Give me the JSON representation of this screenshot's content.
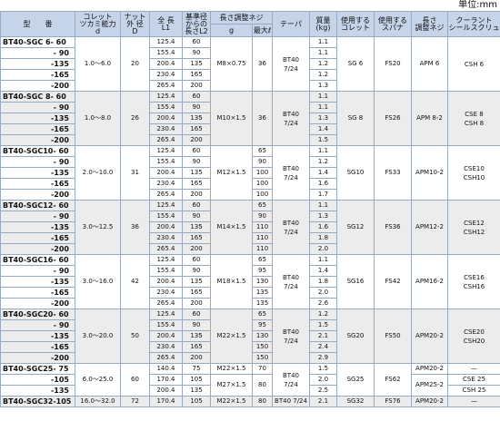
{
  "unit_label": "単位:mm",
  "header": {
    "model": "型　　番",
    "collet_capacity": "コレット",
    "collet_capacity_2": "ツカミ能力",
    "collet_capacity_3": "d",
    "nut_od": "ナット",
    "nut_od_2": "外 径",
    "nut_od_3": "D",
    "length": "全 長",
    "length_2": "L1",
    "ref_length": "基準径",
    "ref_length_2": "からの",
    "ref_length_3": "長さL2",
    "adj_screw": "長さ調整ネジ",
    "adj_screw_g": "g",
    "adj_screw_max": "最大ℓ",
    "taper": "テーパ",
    "mass": "質量",
    "mass_2": "(kg)",
    "collet_used": "使用する",
    "collet_used_2": "コレット",
    "spanner": "使用する",
    "spanner_2": "スパナ",
    "length_adj": "長さ",
    "length_adj_2": "調整ネジ",
    "coolant": "クーラント",
    "coolant_2": "シールスクリュ"
  },
  "groups": [
    {
      "rows": [
        {
          "model": "BT40-SGC  6-  60",
          "L1": "125.4",
          "L2": "60",
          "mass": "1.1"
        },
        {
          "model": "-  90",
          "L1": "155.4",
          "L2": "90",
          "mass": "1.1"
        },
        {
          "model": "-135",
          "L1": "200.4",
          "L2": "135",
          "mass": "1.2"
        },
        {
          "model": "-165",
          "L1": "230.4",
          "L2": "165",
          "mass": "1.2"
        },
        {
          "model": "-200",
          "L1": "265.4",
          "L2": "200",
          "mass": "1.3"
        }
      ],
      "capacity": "1.0〜6.0",
      "nut": "20",
      "g": [
        {
          "text": "M8×0.75",
          "span": 5
        }
      ],
      "lmax": [
        {
          "text": "36",
          "span": 5
        }
      ],
      "taper": "BT40",
      "taper_2": "7/24",
      "collet": "SG 6",
      "spanner": "FS20",
      "adj": "APM  6",
      "coolant": "CSH 6",
      "coolant_2": ""
    },
    {
      "rows": [
        {
          "model": "BT40-SGC  8-  60",
          "L1": "125.4",
          "L2": "60",
          "mass": "1.1"
        },
        {
          "model": "-  90",
          "L1": "155.4",
          "L2": "90",
          "mass": "1.1"
        },
        {
          "model": "-135",
          "L1": "200.4",
          "L2": "135",
          "mass": "1.3"
        },
        {
          "model": "-165",
          "L1": "230.4",
          "L2": "165",
          "mass": "1.4"
        },
        {
          "model": "-200",
          "L1": "265.4",
          "L2": "200",
          "mass": "1.5"
        }
      ],
      "capacity": "1.0〜8.0",
      "nut": "26",
      "g": [
        {
          "text": "M10×1.5",
          "span": 5
        }
      ],
      "lmax": [
        {
          "text": "36",
          "span": 5
        }
      ],
      "taper": "BT40",
      "taper_2": "7/24",
      "collet": "SG 8",
      "spanner": "FS26",
      "adj": "APM  8-2",
      "coolant": "CSE  8",
      "coolant_2": "CSH  8"
    },
    {
      "rows": [
        {
          "model": "BT40-SGC10-  60",
          "L1": "125.4",
          "L2": "60",
          "mass": "1.1"
        },
        {
          "model": "-  90",
          "L1": "155.4",
          "L2": "90",
          "mass": "1.2"
        },
        {
          "model": "-135",
          "L1": "200.4",
          "L2": "135",
          "mass": "1.4"
        },
        {
          "model": "-165",
          "L1": "230.4",
          "L2": "165",
          "mass": "1.6"
        },
        {
          "model": "-200",
          "L1": "265.4",
          "L2": "200",
          "mass": "1.7"
        }
      ],
      "capacity": "2.0〜10.0",
      "nut": "31",
      "g": [
        {
          "text": "M12×1.5",
          "span": 5
        }
      ],
      "lmax_rows": [
        "65",
        "90",
        "100",
        "100",
        "100"
      ],
      "taper": "BT40",
      "taper_2": "7/24",
      "collet": "SG10",
      "spanner": "FS33",
      "adj": "APM10-2",
      "coolant": "CSE10",
      "coolant_2": "CSH10"
    },
    {
      "rows": [
        {
          "model": "BT40-SGC12-  60",
          "L1": "125.4",
          "L2": "60",
          "mass": "1.1"
        },
        {
          "model": "-  90",
          "L1": "155.4",
          "L2": "90",
          "mass": "1.3"
        },
        {
          "model": "-135",
          "L1": "200.4",
          "L2": "135",
          "mass": "1.6"
        },
        {
          "model": "-165",
          "L1": "230.4",
          "L2": "165",
          "mass": "1.8"
        },
        {
          "model": "-200",
          "L1": "265.4",
          "L2": "200",
          "mass": "2.0"
        }
      ],
      "capacity": "3.0〜12.5",
      "nut": "36",
      "g": [
        {
          "text": "M14×1.5",
          "span": 5
        }
      ],
      "lmax_rows": [
        "65",
        "90",
        "110",
        "110",
        "110"
      ],
      "taper": "BT40",
      "taper_2": "7/24",
      "collet": "SG12",
      "spanner": "FS36",
      "adj": "APM12-2",
      "coolant": "CSE12",
      "coolant_2": "CSH12"
    },
    {
      "rows": [
        {
          "model": "BT40-SGC16-  60",
          "L1": "125.4",
          "L2": "60",
          "mass": "1.1"
        },
        {
          "model": "-  90",
          "L1": "155.4",
          "L2": "90",
          "mass": "1.4"
        },
        {
          "model": "-135",
          "L1": "200.4",
          "L2": "135",
          "mass": "1.8"
        },
        {
          "model": "-165",
          "L1": "230.4",
          "L2": "165",
          "mass": "2.0"
        },
        {
          "model": "-200",
          "L1": "265.4",
          "L2": "200",
          "mass": "2.6"
        }
      ],
      "capacity": "3.0〜16.0",
      "nut": "42",
      "g": [
        {
          "text": "M18×1.5",
          "span": 5
        }
      ],
      "lmax_rows": [
        "65",
        "95",
        "130",
        "135",
        "135"
      ],
      "taper": "BT40",
      "taper_2": "7/24",
      "collet": "SG16",
      "spanner": "FS42",
      "adj": "APM16-2",
      "coolant": "CSE16",
      "coolant_2": "CSH16"
    },
    {
      "rows": [
        {
          "model": "BT40-SGC20-  60",
          "L1": "125.4",
          "L2": "60",
          "mass": "1.2"
        },
        {
          "model": "-  90",
          "L1": "155.4",
          "L2": "90",
          "mass": "1.5"
        },
        {
          "model": "-135",
          "L1": "200.4",
          "L2": "135",
          "mass": "2.1"
        },
        {
          "model": "-165",
          "L1": "230.4",
          "L2": "165",
          "mass": "2.4"
        },
        {
          "model": "-200",
          "L1": "265.4",
          "L2": "200",
          "mass": "2.9"
        }
      ],
      "capacity": "3.0〜20.0",
      "nut": "50",
      "g": [
        {
          "text": "M22×1.5",
          "span": 5
        }
      ],
      "lmax_rows": [
        "65",
        "95",
        "130",
        "150",
        "150"
      ],
      "taper": "BT40",
      "taper_2": "7/24",
      "collet": "SG20",
      "spanner": "FS50",
      "adj": "APM20-2",
      "coolant": "CSE20",
      "coolant_2": "CSH20"
    }
  ],
  "sgc25": {
    "rows": [
      {
        "model": "BT40-SGC25-  75",
        "L1": "140.4",
        "L2": "75",
        "g": "M22×1.5",
        "lmax": "70",
        "mass": "1.5",
        "adj": "APM20-2",
        "coolant": "—"
      },
      {
        "model": "-105",
        "L1": "170.4",
        "L2": "105",
        "g": "M27×1.5",
        "lmax": "80",
        "mass": "2.0",
        "adj": "APM25-2",
        "coolant": "CSE 25"
      },
      {
        "model": "-135",
        "L1": "200.4",
        "L2": "135",
        "g": "",
        "lmax": "",
        "mass": "2.5",
        "adj": "",
        "coolant": "CSH 25"
      }
    ],
    "capacity": "6.0〜25.0",
    "nut": "60",
    "taper": "BT40",
    "taper_2": "7/24",
    "collet": "SG25",
    "spanner": "FS62"
  },
  "sgc32": {
    "model": "BT40-SGC32-105",
    "capacity": "16.0〜32.0",
    "nut": "72",
    "L1": "170.4",
    "L2": "105",
    "g": "M22×1.5",
    "lmax": "80",
    "taper": "BT40 7/24",
    "mass": "2.1",
    "collet": "SG32",
    "spanner": "FS76",
    "adj": "APM20-2",
    "coolant": "—"
  }
}
